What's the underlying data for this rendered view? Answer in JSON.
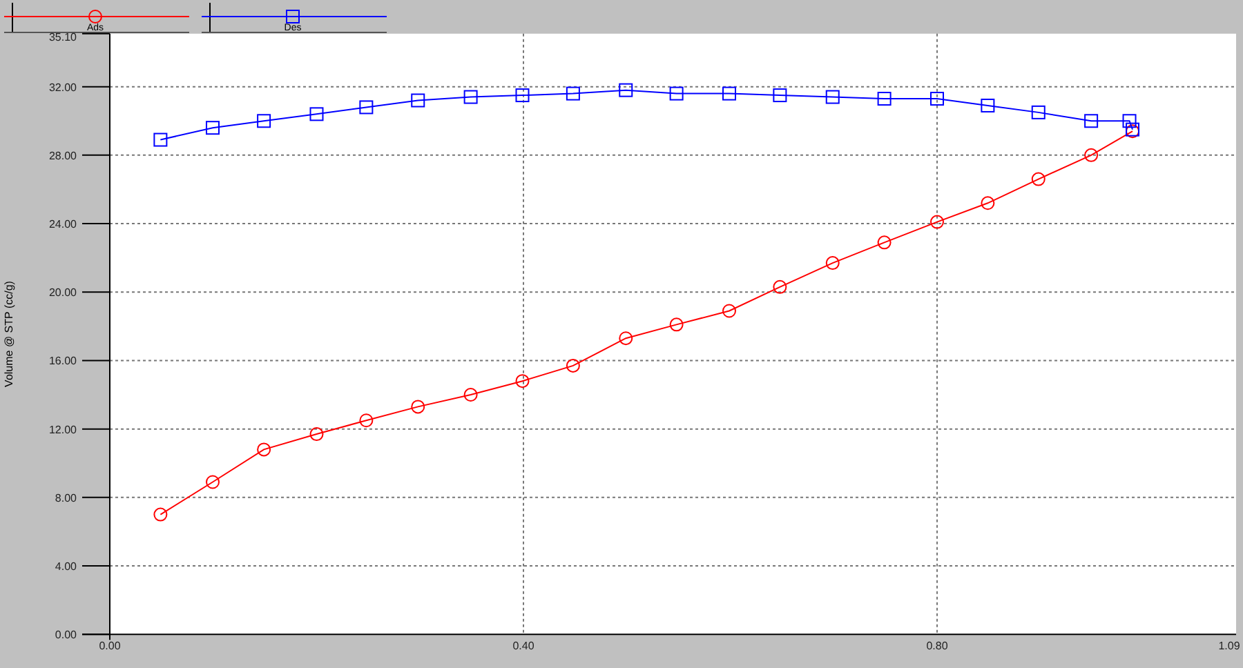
{
  "chart_data": {
    "type": "line",
    "grid": true,
    "legend": "top",
    "ylabel": "Volume @ STP (cc/g)",
    "x": [
      0.049,
      0.0995,
      0.149,
      0.2,
      0.248,
      0.298,
      0.349,
      0.399,
      0.448,
      0.499,
      0.548,
      0.599,
      0.648,
      0.699,
      0.749,
      0.8,
      0.849,
      0.898,
      0.949,
      0.986,
      0.989
    ],
    "series": [
      {
        "name": "Ads",
        "color": "#ff0000",
        "marker": "circle",
        "values": [
          7.0,
          8.9,
          10.8,
          11.7,
          12.5,
          13.3,
          14.0,
          14.8,
          15.7,
          17.3,
          18.1,
          18.9,
          20.3,
          21.7,
          22.9,
          24.1,
          25.2,
          26.6,
          28.0,
          null,
          29.4
        ]
      },
      {
        "name": "Des",
        "color": "#0000ff",
        "marker": "square",
        "values": [
          28.9,
          29.6,
          30.0,
          30.4,
          30.8,
          31.2,
          31.4,
          31.5,
          31.6,
          31.8,
          31.6,
          31.6,
          31.5,
          31.4,
          31.3,
          31.3,
          30.9,
          30.5,
          30.0,
          30.0,
          29.5
        ]
      }
    ],
    "xlim": [
      0,
      1.09
    ],
    "ylim": [
      0,
      35.1
    ],
    "xticks": [
      {
        "value": 0,
        "label": "0.00"
      },
      {
        "value": 0.4,
        "label": "0.40"
      },
      {
        "value": 0.8,
        "label": "0.80"
      },
      {
        "value": 1.09,
        "label": "1.09"
      }
    ],
    "yticks": [
      {
        "value": 0,
        "label": "0.00"
      },
      {
        "value": 4,
        "label": "4.00"
      },
      {
        "value": 8,
        "label": "8.00"
      },
      {
        "value": 12,
        "label": "12.00"
      },
      {
        "value": 16,
        "label": "16.00"
      },
      {
        "value": 20,
        "label": "20.00"
      },
      {
        "value": 24,
        "label": "24.00"
      },
      {
        "value": 28,
        "label": "28.00"
      },
      {
        "value": 32,
        "label": "32.00"
      },
      {
        "value": 35.1,
        "label": "35.10"
      }
    ]
  }
}
